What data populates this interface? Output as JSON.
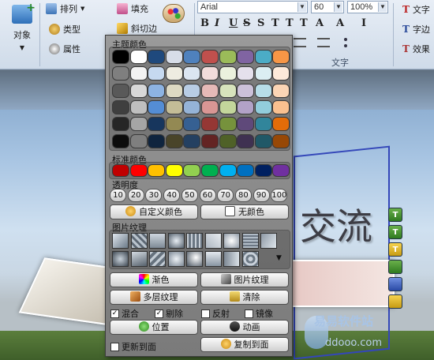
{
  "ribbon": {
    "object_label": "对象",
    "arrange_label": "排列",
    "type_label": "类型",
    "property_label": "属性",
    "fill_label": "填充",
    "bevel_label": "斜切边",
    "font_name": "Arial",
    "font_size": "60",
    "zoom": "100%",
    "text_group_label": "文字",
    "text_btn_label": "文字",
    "char_spacing_label": "字边",
    "effect_label": "效果",
    "tool_glyphs": [
      "B",
      "I",
      "U",
      "S",
      "S",
      "T",
      "T",
      "T",
      "A",
      "A",
      "I"
    ]
  },
  "canvas": {
    "headline_text": "交流",
    "watermark_text": "易易软件站",
    "watermark_url": "ddooo.com",
    "side_buttons": [
      "T",
      "T",
      "T",
      "",
      "",
      ""
    ]
  },
  "panel": {
    "theme_colors_label": "主题颜色",
    "theme_colors": [
      [
        "#000000",
        "#ffffff",
        "#1f497d",
        "#d7dde8",
        "#4f81bd",
        "#c0504d",
        "#9bbb59",
        "#8064a2",
        "#4bacc6",
        "#f79646"
      ],
      [
        "#7f7f7f",
        "#f2f2f2",
        "#c6d9f0",
        "#eeece1",
        "#dbe5f1",
        "#f2dcdb",
        "#ebf1dd",
        "#e5e0ec",
        "#dbeef3",
        "#fdeada"
      ],
      [
        "#595959",
        "#d8d8d8",
        "#8db3e2",
        "#ddd9c3",
        "#b8cce4",
        "#e5b9b7",
        "#d7e3bc",
        "#ccc1d9",
        "#b7dde8",
        "#fbd5b5"
      ],
      [
        "#3f3f3f",
        "#bfbfbf",
        "#548dd4",
        "#c4bd97",
        "#95b3d7",
        "#d99694",
        "#c3d69b",
        "#b2a2c7",
        "#92cddc",
        "#fac08f"
      ],
      [
        "#262626",
        "#a5a5a5",
        "#17365d",
        "#938953",
        "#366092",
        "#953734",
        "#76923c",
        "#5f497a",
        "#31859b",
        "#e36c09"
      ],
      [
        "#0c0c0c",
        "#7f7f7f",
        "#0f243e",
        "#494429",
        "#244061",
        "#632423",
        "#4f6128",
        "#3f3151",
        "#205867",
        "#974806"
      ]
    ],
    "standard_colors_label": "标准颜色",
    "standard_colors": [
      "#c00000",
      "#ff0000",
      "#ffc000",
      "#ffff00",
      "#92d050",
      "#00b050",
      "#00b0f0",
      "#0070c0",
      "#002060",
      "#7030a0"
    ],
    "transparency_label": "透明度",
    "transparency_values": [
      "10",
      "20",
      "30",
      "40",
      "50",
      "60",
      "70",
      "80",
      "90",
      "100"
    ],
    "custom_color_label": "自定义颜色",
    "no_color_label": "无颜色",
    "picture_texture_label": "图片纹理",
    "gradient_label": "渐色",
    "picture_texture_button": "图片纹理",
    "multi_texture_label": "多层纹理",
    "clear_label": "清除",
    "options": [
      {
        "label": "混合",
        "checked": true
      },
      {
        "label": "剔除",
        "checked": true
      },
      {
        "label": "反射",
        "checked": false
      },
      {
        "label": "镜像",
        "checked": false
      }
    ],
    "position_label": "位置",
    "animation_label": "动画",
    "update_to_face_label": "更新到面",
    "update_to_face_checked": false,
    "copy_to_face_label": "复制到面"
  }
}
